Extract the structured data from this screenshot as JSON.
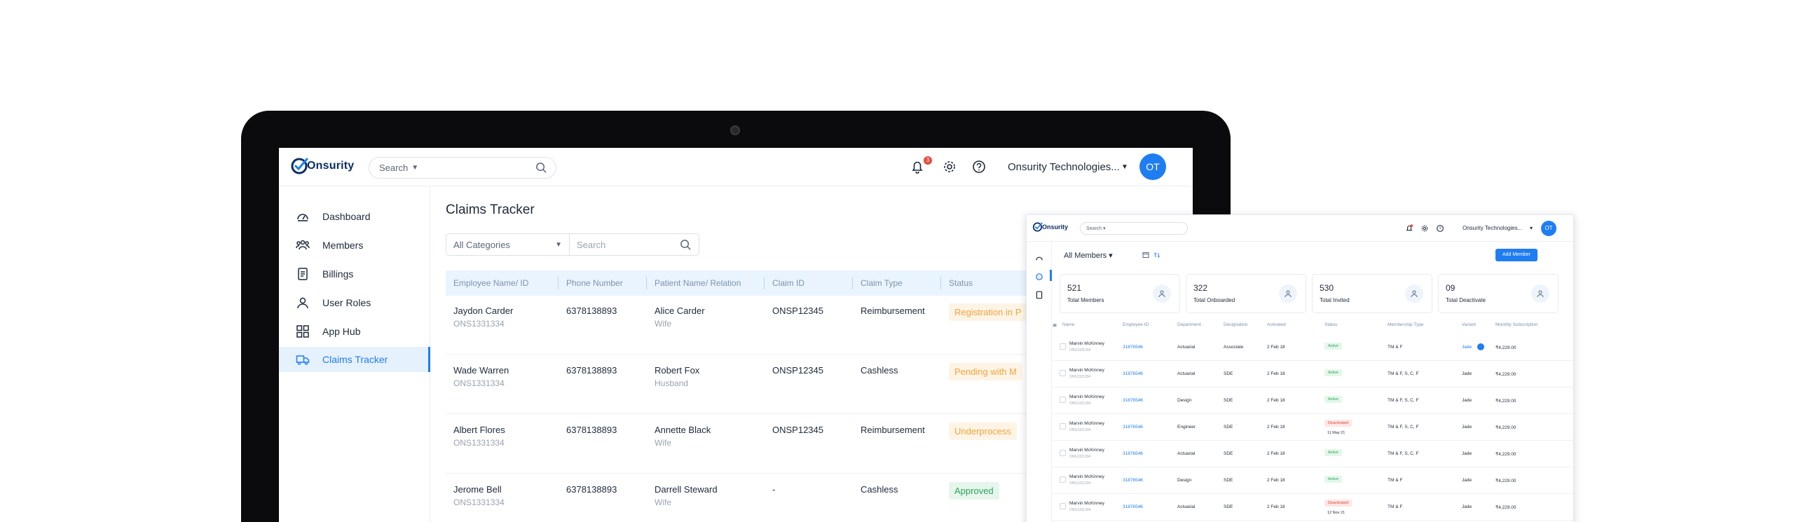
{
  "app": {
    "brand": "Onsurity",
    "search": {
      "label": "Search"
    },
    "notification_count": "3",
    "company": "Onsurity Technologies...",
    "avatar_initials": "OT"
  },
  "sidebar": {
    "items": [
      {
        "label": "Dashboard",
        "icon": "dashboard-icon"
      },
      {
        "label": "Members",
        "icon": "members-icon"
      },
      {
        "label": "Billings",
        "icon": "billings-icon"
      },
      {
        "label": "User Roles",
        "icon": "user-roles-icon"
      },
      {
        "label": "App Hub",
        "icon": "app-hub-icon"
      },
      {
        "label": "Claims Tracker",
        "icon": "claims-tracker-icon",
        "active": true
      }
    ]
  },
  "claims": {
    "title": "Claims Tracker",
    "category_select": "All Categories",
    "search_placeholder": "Search",
    "columns": [
      "Employee Name/ ID",
      "Phone Number",
      "Patient Name/ Relation",
      "Claim ID",
      "Claim Type",
      "Status"
    ],
    "rows": [
      {
        "employee": "Jaydon Carder",
        "employee_id": "ONS1331334",
        "phone": "6378138893",
        "patient": "Alice Carder",
        "relation": "Wife",
        "claim_id": "ONSP12345",
        "claim_type": "Reimbursement",
        "status": "Registration in P"
      },
      {
        "employee": "Wade Warren",
        "employee_id": "ONS1331334",
        "phone": "6378138893",
        "patient": "Robert Fox",
        "relation": "Husband",
        "claim_id": "ONSP12345",
        "claim_type": "Cashless",
        "status": "Pending with M"
      },
      {
        "employee": "Albert Flores",
        "employee_id": "ONS1331334",
        "phone": "6378138893",
        "patient": "Annette Black",
        "relation": "Wife",
        "claim_id": "ONSP12345",
        "claim_type": "Reimbursement",
        "status": "Underprocess"
      },
      {
        "employee": "Jerome Bell",
        "employee_id": "ONS1331334",
        "phone": "6378138893",
        "patient": "Darrell Steward",
        "relation": "Wife",
        "claim_id": "-",
        "claim_type": "Cashless",
        "status": "Approved"
      }
    ]
  },
  "members_view": {
    "brand": "Onsurity",
    "search_label": "Search",
    "company": "Onsurity Technologies...",
    "avatar_initials": "OT",
    "filter_label": "All Members",
    "add_button": "Add Member",
    "stats": [
      {
        "value": "521",
        "label": "Total Members"
      },
      {
        "value": "322",
        "label": "Total Onboarded"
      },
      {
        "value": "530",
        "label": "Total Invited"
      },
      {
        "value": "09",
        "label": "Total Deactivate"
      }
    ],
    "columns": [
      "Name",
      "Employee ID",
      "Department",
      "Designation",
      "Activated",
      "Status",
      "Membership Type",
      "Variant",
      "Monthly Subscription"
    ],
    "rows": [
      {
        "name": "Marvin McKinney",
        "sub": "ONS1331334",
        "emp_id": "31876546",
        "dept": "Actuarial",
        "desig": "Associate",
        "activated": "2 Feb 18",
        "status": "Active",
        "membership": "TM & F",
        "variant": "Jade",
        "subscription": "₹4,229.00"
      },
      {
        "name": "Marvin McKinney",
        "sub": "ONS1331334",
        "emp_id": "31876546",
        "dept": "Actuarial",
        "desig": "SDE",
        "activated": "2 Feb 18",
        "status": "Active",
        "membership": "TM & F, S, C, F",
        "variant": "Jade",
        "subscription": "₹4,229.00"
      },
      {
        "name": "Marvin McKinney",
        "sub": "ONS1331334",
        "emp_id": "31876546",
        "dept": "Design",
        "desig": "SDE",
        "activated": "2 Feb 18",
        "status": "Active",
        "membership": "TM & F, S, C, F",
        "variant": "Jade",
        "subscription": "₹4,229.00"
      },
      {
        "name": "Marvin McKinney",
        "sub": "ONS1331334",
        "emp_id": "31876546",
        "dept": "Engineer",
        "desig": "SDE",
        "activated": "2 Feb 18",
        "status": "Deactivated",
        "status_date": "11 May 21",
        "membership": "TM & F, S, C, F",
        "variant": "Jade",
        "subscription": "₹4,229.00"
      },
      {
        "name": "Marvin McKinney",
        "sub": "ONS1331334",
        "emp_id": "31876546",
        "dept": "Actuarial",
        "desig": "SDE",
        "activated": "2 Feb 18",
        "status": "Active",
        "membership": "TM & F, S, C, F",
        "variant": "Jade",
        "subscription": "₹4,229.00"
      },
      {
        "name": "Marvin McKinney",
        "sub": "ONS1331334",
        "emp_id": "31876546",
        "dept": "Design",
        "desig": "SDE",
        "activated": "2 Feb 18",
        "status": "Active",
        "membership": "TM & F",
        "variant": "Jade",
        "subscription": "₹4,229.00"
      },
      {
        "name": "Marvin McKinney",
        "sub": "ONS1331334",
        "emp_id": "31876546",
        "dept": "Actuarial",
        "desig": "SDE",
        "activated": "2 Feb 18",
        "status": "Deactivated",
        "status_date": "12 Nov 21",
        "membership": "TM & F",
        "variant": "Jade",
        "subscription": "₹4,229.00"
      }
    ]
  },
  "colors": {
    "accent": "#1f7df2",
    "brand_navy": "#0b2e66",
    "status_registration": "#f3a43a",
    "status_pending": "#f3a43a",
    "status_underprocess": "#f3a43a",
    "status_approved": "#2aa35a",
    "badge_active": "#2aa35a",
    "badge_deactivated": "#e2483b"
  }
}
